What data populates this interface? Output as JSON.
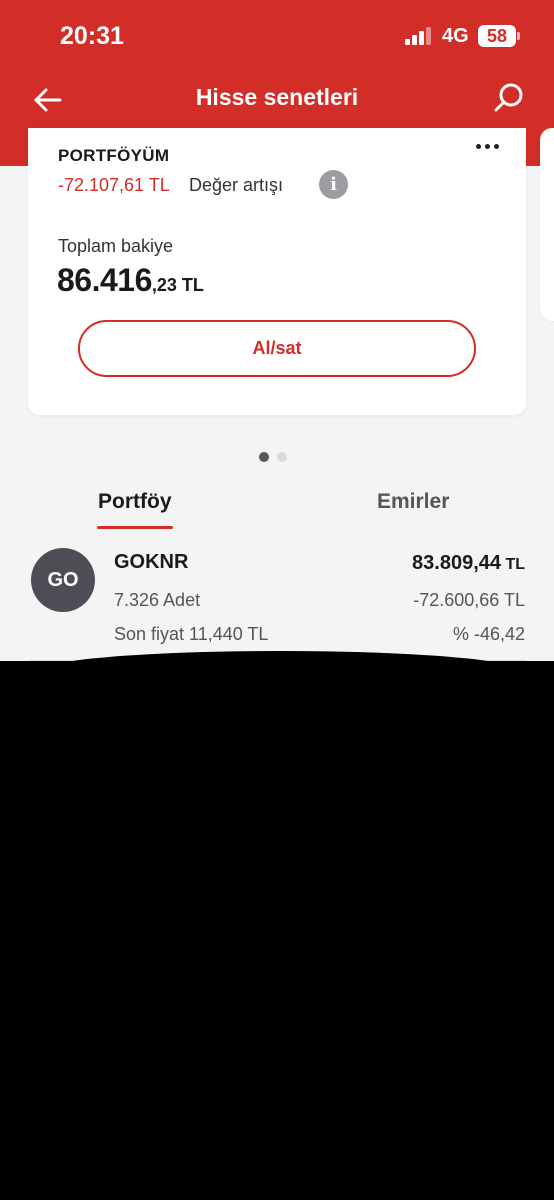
{
  "status_bar": {
    "time": "20:31",
    "network": "4G",
    "battery": "58"
  },
  "nav": {
    "title": "Hisse senetleri",
    "back_icon": "arrow-left-icon",
    "search_icon": "search-icon"
  },
  "portfolio_card": {
    "title": "PORTFÖYÜM",
    "gain_value": "-72.107,61 TL",
    "gain_label": "Değer artışı",
    "info_icon": "i",
    "balance_label": "Toplam bakiye",
    "balance_int": "86.416",
    "balance_dec": ",23 TL",
    "buy_sell_label": "Al/sat"
  },
  "carousel": {
    "pages": 2,
    "active": 0
  },
  "tabs": [
    {
      "label": "Portföy",
      "active": true
    },
    {
      "label": "Emirler",
      "active": false
    }
  ],
  "holdings": [
    {
      "avatar": "GO",
      "symbol": "GOKNR",
      "quantity": "7.326 Adet",
      "last_price": "Son fiyat 11,440 TL",
      "value_int": "83.809,44",
      "value_unit": " TL",
      "profit_loss": "-72.600,66 TL",
      "percent": "% -46,42"
    }
  ],
  "colors": {
    "brand": "#d22d26",
    "negative": "#d22d26",
    "avatar_bg": "#4d4e55"
  }
}
